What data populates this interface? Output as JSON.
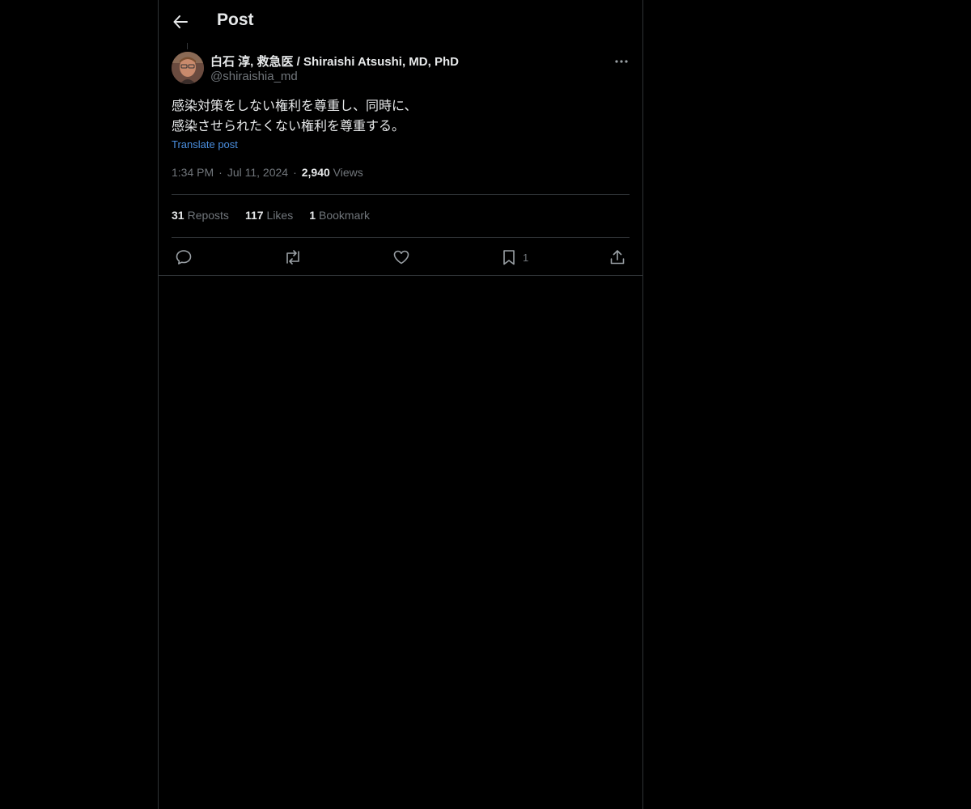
{
  "header": {
    "title": "Post"
  },
  "post": {
    "author_name": "白石 淳, 救急医 / Shiraishi Atsushi, MD, PhD",
    "author_handle": "@shiraishia_md",
    "text": "感染対策をしない権利を尊重し、同時に、\n感染させられたくない権利を尊重する。",
    "translate_label": "Translate post",
    "time": "1:34 PM",
    "date": "Jul 11, 2024",
    "views_count": "2,940",
    "views_label": "Views"
  },
  "stats": {
    "reposts_count": "31",
    "reposts_label": "Reposts",
    "likes_count": "117",
    "likes_label": "Likes",
    "bookmarks_count": "1",
    "bookmarks_label": "Bookmark"
  },
  "actions": {
    "bookmark_count": "1"
  },
  "colors": {
    "background": "#000000",
    "text_primary": "#e7e9ea",
    "text_secondary": "#71767b",
    "link": "#4a8ede",
    "border": "#2f3336"
  }
}
